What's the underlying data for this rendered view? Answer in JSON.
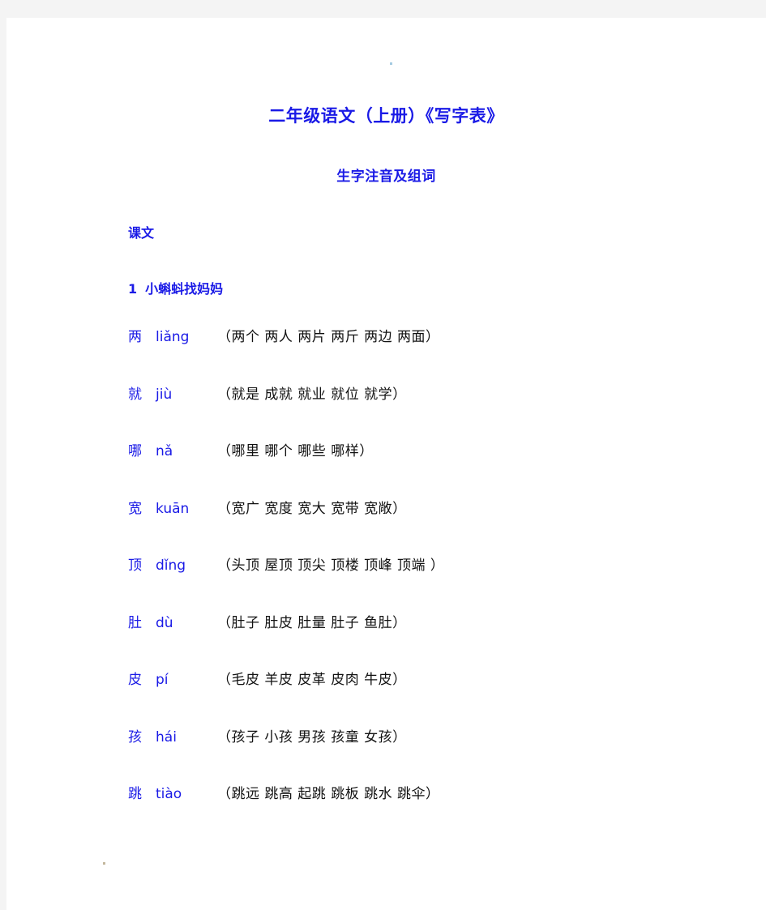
{
  "document": {
    "title_main": "二年级语文（上册）《写字表》",
    "title_sub": "生字注音及组词",
    "section_label": "课文",
    "lesson": {
      "number": "1",
      "name": "小蝌蚪找妈妈"
    },
    "colors": {
      "heading_blue": "#1a1ae6",
      "body_black": "#111111",
      "page_white": "#ffffff",
      "canvas_gray": "#f4f4f4"
    },
    "entries": [
      {
        "character": "两",
        "pinyin": "liǎng",
        "words": "（两个  两人  两片  两斤  两边  两面）"
      },
      {
        "character": "就",
        "pinyin": "jiù",
        "words": "（就是  成就  就业  就位  就学）"
      },
      {
        "character": "哪",
        "pinyin": "nǎ",
        "words": "（哪里  哪个  哪些  哪样）"
      },
      {
        "character": "宽",
        "pinyin": "kuān",
        "words": "（宽广  宽度  宽大  宽带  宽敞）"
      },
      {
        "character": "顶",
        "pinyin": "dǐng",
        "words": "（头顶  屋顶  顶尖  顶楼  顶峰  顶端  ）"
      },
      {
        "character": "肚",
        "pinyin": "dù",
        "words": "（肚子  肚皮  肚量  肚子  鱼肚）"
      },
      {
        "character": "皮",
        "pinyin": "pí",
        "words": "（毛皮  羊皮  皮革  皮肉  牛皮）"
      },
      {
        "character": "孩",
        "pinyin": "hái",
        "words": "（孩子  小孩  男孩  孩童  女孩）"
      },
      {
        "character": "跳",
        "pinyin": "tiào",
        "words": "（跳远  跳高  起跳  跳板  跳水  跳伞）"
      }
    ]
  }
}
